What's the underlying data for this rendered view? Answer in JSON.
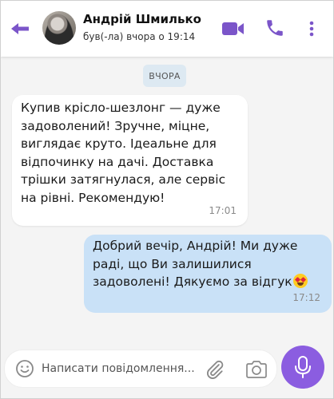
{
  "header": {
    "back_icon": "arrow-left-icon",
    "contact_name": "Андрій Шмилько",
    "status": "був(-ла) вчора о 19:14",
    "video_icon": "video-camera-icon",
    "call_icon": "phone-icon",
    "more_icon": "more-vertical-icon"
  },
  "date_separator": "ВЧОРА",
  "messages": [
    {
      "direction": "incoming",
      "text": "Купив крісло-шезлонг — дуже задоволений! Зручне, міцне, виглядає круто. Ідеальне для відпочинку на дачі. Доставка трішки затягнулася, але сервіс на рівні. Рекомендую!",
      "time": "17:01"
    },
    {
      "direction": "outgoing",
      "text": "Добрий вечір, Андрій! Ми дуже раді, що Ви залишилися задоволені! Дякуємо за відгук",
      "emoji": "star-struck-emoji",
      "time": "17:12"
    }
  ],
  "composer": {
    "emoji_icon": "smiley-icon",
    "placeholder": "Написати повідомлення...",
    "attach_icon": "paperclip-icon",
    "camera_icon": "camera-icon",
    "mic_icon": "microphone-icon"
  },
  "colors": {
    "accent": "#8b5de0",
    "outgoing_bubble": "#c9e1f7",
    "incoming_bubble": "#ffffff",
    "date_badge": "#dde9f2",
    "chat_background": "#f4f4f4"
  }
}
